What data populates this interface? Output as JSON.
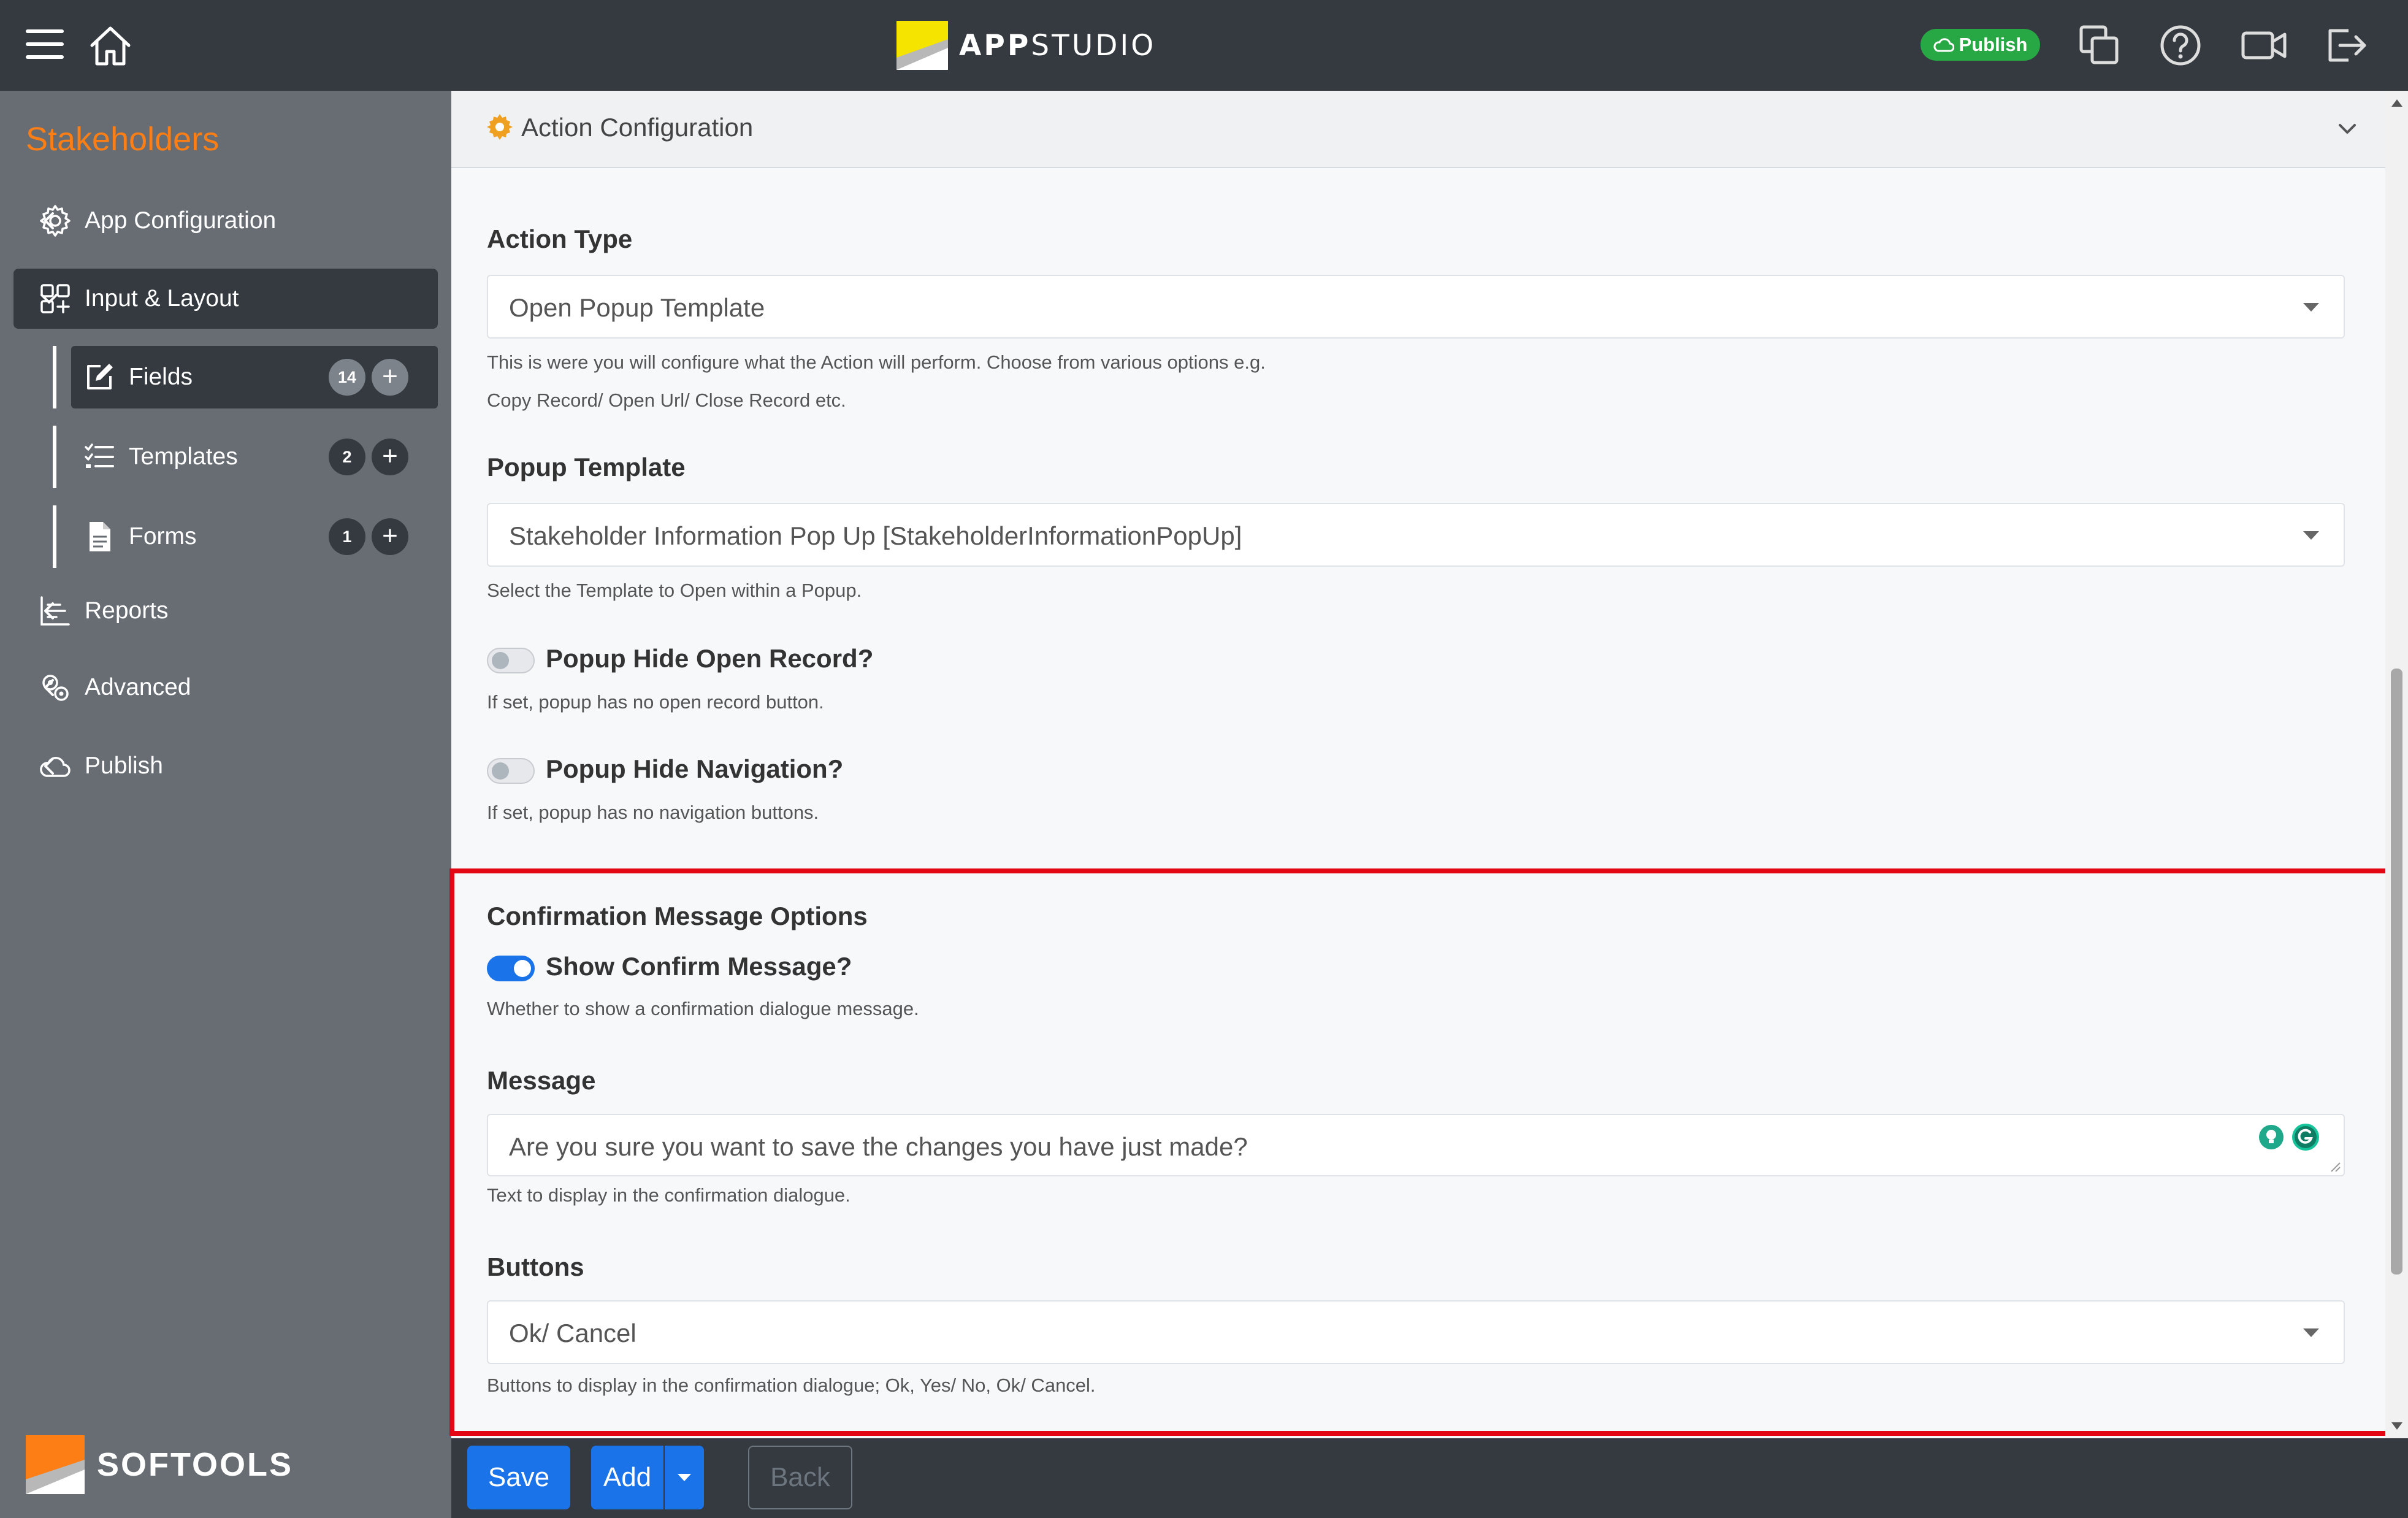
{
  "topbar": {
    "brand_bold": "APP",
    "brand_light": "STUDIO",
    "publish_label": "Publish"
  },
  "sidebar": {
    "title": "Stakeholders",
    "items": [
      {
        "label": "App Configuration",
        "icon": "gear-icon"
      },
      {
        "label": "Input & Layout",
        "icon": "layout-icon"
      },
      {
        "label": "Reports",
        "icon": "reports-icon"
      },
      {
        "label": "Advanced",
        "icon": "advanced-gears-icon"
      },
      {
        "label": "Publish",
        "icon": "cloud-icon"
      }
    ],
    "sub_items": [
      {
        "label": "Fields",
        "count": "14",
        "icon": "edit-icon"
      },
      {
        "label": "Templates",
        "count": "2",
        "icon": "list-check-icon"
      },
      {
        "label": "Forms",
        "count": "1",
        "icon": "document-icon"
      }
    ],
    "footer_text": "SOFTOOLS"
  },
  "main": {
    "section_title": "Action Configuration",
    "action_type": {
      "label": "Action Type",
      "value": "Open Popup Template",
      "help_line1": "This is were you will configure what the Action will perform. Choose from various options e.g.",
      "help_line2": "Copy Record/ Open Url/ Close Record etc."
    },
    "popup_template": {
      "label": "Popup Template",
      "value": "Stakeholder Information Pop Up [StakeholderInformationPopUp]",
      "help": "Select the Template to Open within a Popup."
    },
    "popup_hide_open_record": {
      "label": "Popup Hide Open Record?",
      "checked": false,
      "help": "If set, popup has no open record button."
    },
    "popup_hide_navigation": {
      "label": "Popup Hide Navigation?",
      "checked": false,
      "help": "If set, popup has no navigation buttons."
    },
    "confirmation": {
      "section_label": "Confirmation Message Options",
      "show_label": "Show Confirm Message?",
      "show_checked": true,
      "show_help": "Whether to show a confirmation dialogue message.",
      "message_label": "Message",
      "message_value": "Are you sure you want to save the changes you have just made?",
      "message_help": "Text to display in the confirmation dialogue.",
      "buttons_label": "Buttons",
      "buttons_value": "Ok/ Cancel",
      "buttons_help": "Buttons to display in the confirmation dialogue; Ok, Yes/ No, Ok/ Cancel."
    },
    "highlight_color": "#e30613"
  },
  "footer": {
    "save_label": "Save",
    "add_label": "Add",
    "back_label": "Back"
  },
  "colors": {
    "accent": "#1a73e8",
    "brand_orange": "#fd7e14",
    "publish_green": "#28a745",
    "dark": "#343a40"
  }
}
